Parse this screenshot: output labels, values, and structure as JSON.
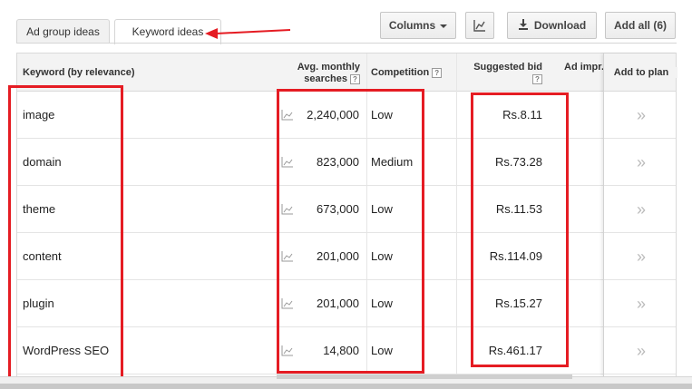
{
  "tabs": {
    "ad_group_ideas": "Ad group ideas",
    "keyword_ideas": "Keyword ideas"
  },
  "toolbar": {
    "columns_label": "Columns",
    "download_label": "Download",
    "add_all_label": "Add all (6)"
  },
  "table": {
    "headers": {
      "keyword": "Keyword (by relevance)",
      "avg_searches_1": "Avg. monthly",
      "avg_searches_2": "searches",
      "competition": "Competition",
      "suggested_bid": "Suggested bid",
      "ad_impr": "Ad impr.",
      "add_to_plan": "Add to plan"
    },
    "help_glyph": "?",
    "add_glyph": "»",
    "rows": [
      {
        "keyword": "image",
        "searches": "2,240,000",
        "competition": "Low",
        "bid": "Rs.8.11"
      },
      {
        "keyword": "domain",
        "searches": "823,000",
        "competition": "Medium",
        "bid": "Rs.73.28"
      },
      {
        "keyword": "theme",
        "searches": "673,000",
        "competition": "Low",
        "bid": "Rs.11.53"
      },
      {
        "keyword": "content",
        "searches": "201,000",
        "competition": "Low",
        "bid": "Rs.114.09"
      },
      {
        "keyword": "plugin",
        "searches": "201,000",
        "competition": "Low",
        "bid": "Rs.15.27"
      },
      {
        "keyword": "WordPress SEO",
        "searches": "14,800",
        "competition": "Low",
        "bid": "Rs.461.17"
      }
    ]
  },
  "colors": {
    "highlight": "#e51c23",
    "header_bg": "#f3f3f3"
  },
  "icons": {
    "trend": "trend-chart-icon",
    "chart": "line-chart-icon",
    "download": "download-icon",
    "arrow": "red-arrow-annotation"
  }
}
